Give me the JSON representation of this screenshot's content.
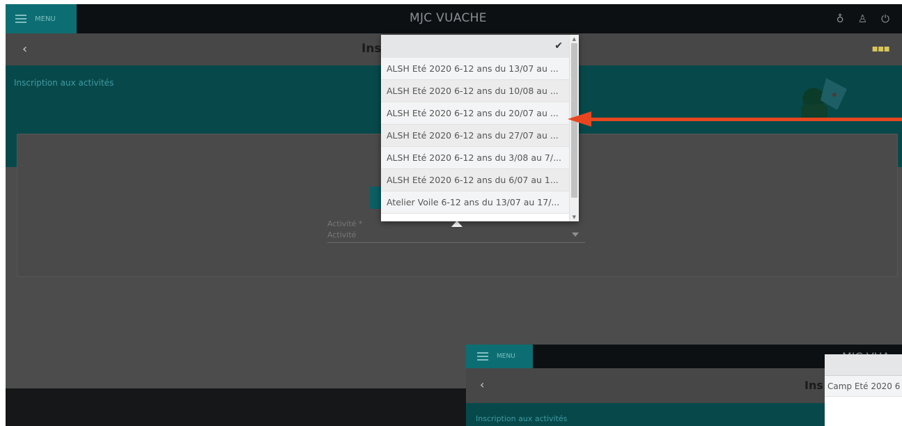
{
  "app": {
    "menu_label": "MENU",
    "title": "MJC VUACHE",
    "page_title": "Ins",
    "banner_text": "Inscription aux activités"
  },
  "form": {
    "field_label": "Activité *",
    "field_value": "Activité"
  },
  "dropdown": {
    "check_icon": "check-icon",
    "options": [
      "ALSH Eté 2020 6-12 ans du 13/07 au ...",
      "ALSH Eté 2020 6-12 ans du 10/08 au ...",
      "ALSH Eté 2020 6-12 ans du 20/07 au ...",
      "ALSH Eté 2020 6-12 ans du 27/07 au ...",
      "ALSH Eté 2020 6-12 ans du 3/08 au 7/...",
      "ALSH Eté 2020 6-12 ans du 6/07 au 1...",
      "Atelier Voile 6-12 ans du 13/07 au 17/..."
    ]
  },
  "inset": {
    "menu_label": "MENU",
    "title": "MJC VUA",
    "page_title": "Ins",
    "banner_text": "Inscription aux activités",
    "dropdown_option": "Camp Eté 2020 6"
  },
  "colors": {
    "accent": "#0c6e72",
    "topbar": "#0d1012",
    "annotation_arrow": "#e8461f"
  }
}
